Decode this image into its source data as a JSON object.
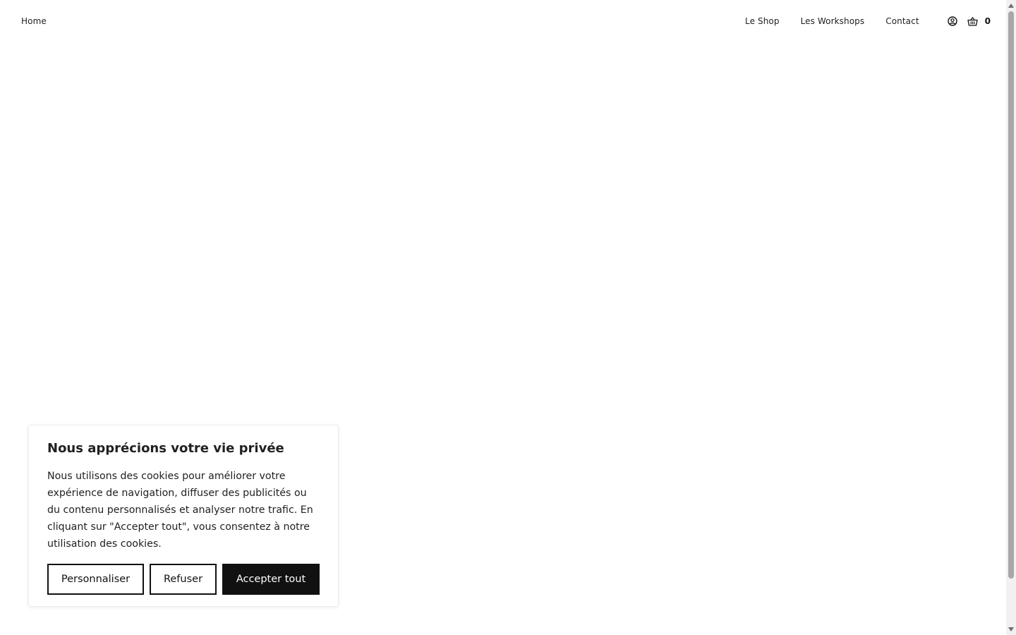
{
  "header": {
    "home_label": "Home",
    "nav": [
      {
        "label": "Le Shop"
      },
      {
        "label": "Les Workshops"
      },
      {
        "label": "Contact"
      }
    ],
    "account_icon": "user-circle-icon",
    "cart_icon": "basket-icon",
    "cart_count": "0"
  },
  "cookie_banner": {
    "title": "Nous apprécions votre vie privée",
    "text": "Nous utilisons des cookies pour améliorer votre expérience de navigation, diffuser des publicités ou du contenu personnalisés et analyser notre trafic. En cliquant sur \"Accepter tout\", vous consentez à notre utilisation des cookies.",
    "buttons": {
      "customize": "Personnaliser",
      "reject": "Refuser",
      "accept": "Accepter tout"
    }
  },
  "colors": {
    "background": "#ffffff",
    "text": "#111111",
    "accent_button": "#111111"
  }
}
